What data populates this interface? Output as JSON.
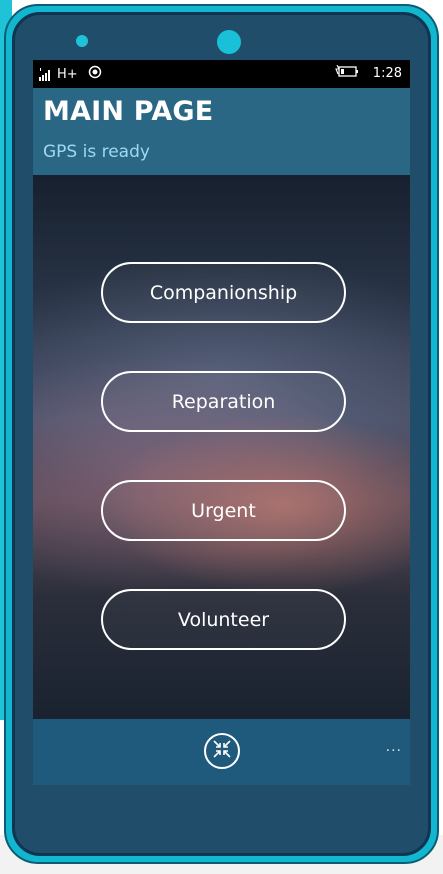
{
  "status_bar": {
    "network": "H+",
    "time": "1:28",
    "signal_icon": "signal-bars-icon",
    "location_icon": "location-ring-icon",
    "battery_icon": "battery-charging-icon"
  },
  "header": {
    "title": "MAIN PAGE",
    "subtitle": "GPS is ready"
  },
  "menu": {
    "buttons": [
      {
        "label": "Companionship"
      },
      {
        "label": "Reparation"
      },
      {
        "label": "Urgent"
      },
      {
        "label": "Volunteer"
      }
    ]
  },
  "app_bar": {
    "center_icon": "collapse-arrows-icon",
    "more": "..."
  },
  "colors": {
    "phone_shell": "#12b7cf",
    "phone_body": "#1f4d6a",
    "header_bg": "#2a6785",
    "subtitle_text": "#9fd8ef",
    "app_bar_bg": "#1f5a7c",
    "button_border": "#ffffff"
  }
}
